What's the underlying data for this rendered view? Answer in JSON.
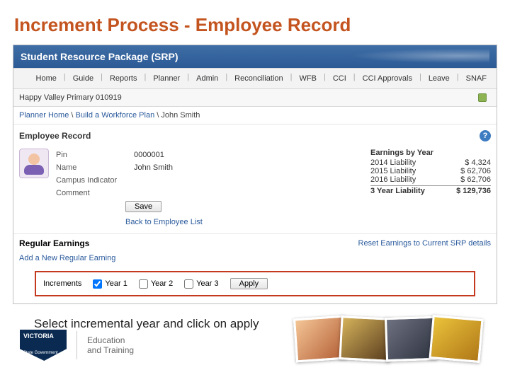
{
  "slide": {
    "title": "Increment Process -  Employee Record",
    "caption": "Select incremental year and click on apply"
  },
  "app": {
    "title": "Student Resource Package (SRP)",
    "nav": [
      "Home",
      "Guide",
      "Reports",
      "Planner",
      "Admin",
      "Reconciliation",
      "WFB",
      "CCI",
      "CCI Approvals",
      "Leave",
      "SNAF"
    ],
    "school": "Happy Valley Primary 010919",
    "breadcrumb": {
      "a": "Planner Home",
      "b": "Build a Workforce Plan",
      "c": "John Smith"
    },
    "section_title": "Employee Record",
    "fields": {
      "pin_label": "Pin",
      "pin_value": "0000001",
      "name_label": "Name",
      "name_value": "John Smith",
      "campus_label": "Campus Indicator",
      "campus_value": "",
      "comment_label": "Comment",
      "comment_value": ""
    },
    "save_label": "Save",
    "back_link": "Back to Employee List",
    "earnings": {
      "title": "Earnings by Year",
      "rows": [
        {
          "label": "2014 Liability",
          "value": "$ 4,324"
        },
        {
          "label": "2015 Liability",
          "value": "$ 62,706"
        },
        {
          "label": "2016 Liability",
          "value": "$ 62,706"
        }
      ],
      "total_label": "3 Year Liability",
      "total_value": "$ 129,736"
    },
    "regular": {
      "title": "Regular Earnings",
      "reset_link": "Reset Earnings to Current SRP details",
      "add_link": "Add a New Regular Earning"
    },
    "increments": {
      "label": "Increments",
      "year1": "Year 1",
      "year2": "Year 2",
      "year3": "Year 3",
      "apply": "Apply"
    }
  },
  "footer": {
    "brand": "VICTORIA",
    "brand_sub": "State Government",
    "dept1": "Education",
    "dept2": "and Training"
  }
}
